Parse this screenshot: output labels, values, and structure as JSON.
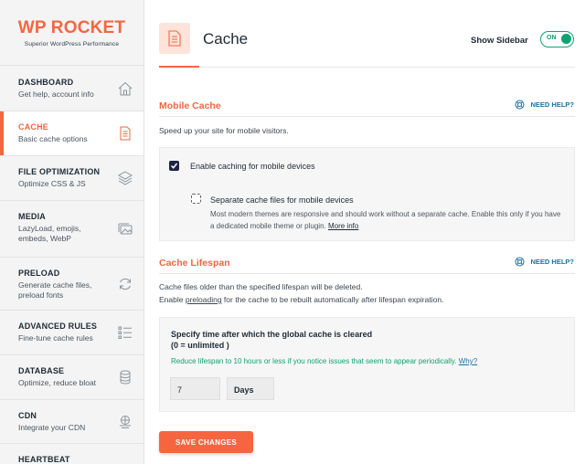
{
  "brand": {
    "name_wp": "WP",
    "name_rocket": "ROCKET",
    "tagline": "Superior WordPress Performance",
    "accent": "#f56640"
  },
  "sidebar": {
    "items": [
      {
        "title": "DASHBOARD",
        "desc": "Get help, account info",
        "icon": "home-icon"
      },
      {
        "title": "CACHE",
        "desc": "Basic cache options",
        "icon": "document-icon"
      },
      {
        "title": "FILE OPTIMIZATION",
        "desc": "Optimize CSS & JS",
        "icon": "layers-icon"
      },
      {
        "title": "MEDIA",
        "desc": "LazyLoad, emojis, embeds, WebP",
        "icon": "images-icon"
      },
      {
        "title": "PRELOAD",
        "desc": "Generate cache files, preload fonts",
        "icon": "refresh-icon"
      },
      {
        "title": "ADVANCED RULES",
        "desc": "Fine-tune cache rules",
        "icon": "list-icon"
      },
      {
        "title": "DATABASE",
        "desc": "Optimize, reduce bloat",
        "icon": "database-icon"
      },
      {
        "title": "CDN",
        "desc": "Integrate your CDN",
        "icon": "cdn-icon"
      },
      {
        "title": "HEARTBEAT",
        "desc": "",
        "icon": "heartbeat-icon"
      }
    ]
  },
  "header": {
    "title": "Cache",
    "show_sidebar_label": "Show Sidebar",
    "toggle_label": "ON"
  },
  "mobile_cache": {
    "title": "Mobile Cache",
    "help_label": "NEED HELP?",
    "description": "Speed up your site for mobile visitors.",
    "enable_label": "Enable caching for mobile devices",
    "separate_label": "Separate cache files for mobile devices",
    "separate_desc": "Most modern themes are responsive and should work without a separate cache. Enable this only if you have a dedicated mobile theme or plugin.",
    "more_info": "More info"
  },
  "cache_lifespan": {
    "title": "Cache Lifespan",
    "help_label": "NEED HELP?",
    "desc_line1": "Cache files older than the specified lifespan will be deleted.",
    "desc_line2_pre": "Enable",
    "desc_line2_link": "preloading",
    "desc_line2_post": "for the cache to be rebuilt automatically after lifespan expiration.",
    "field_title_1": "Specify time after which the global cache is cleared",
    "field_title_2": "(0 = unlimited )",
    "hint": "Reduce lifespan to 10 hours or less if you notice issues that seem to appear periodically.",
    "hint_link": "Why?",
    "value": "7",
    "unit": "Days"
  },
  "save_label": "SAVE CHANGES"
}
